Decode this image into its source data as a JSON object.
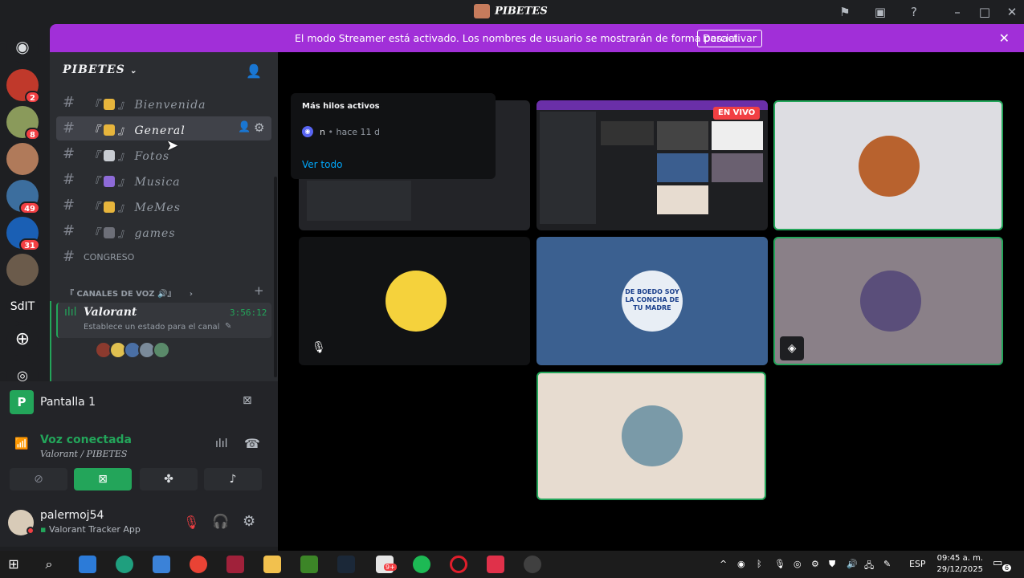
{
  "window": {
    "title": "PIBETES",
    "flag_icon": "flag-icon",
    "inbox_icon": "inbox-icon",
    "help_icon": "help-icon"
  },
  "rail": {
    "servers": [
      {
        "badge": "2",
        "color": "#c0392b"
      },
      {
        "badge": "8",
        "color": "#8a9a5b"
      },
      {
        "badge": "",
        "color": "#b07a5a"
      },
      {
        "badge": "49",
        "color": "#3c6e9e"
      },
      {
        "badge": "31",
        "color": "#1a5fb4"
      },
      {
        "badge": "",
        "color": "#6b5b4b"
      }
    ],
    "text_server": "SdIT"
  },
  "banner": {
    "message": "El modo Streamer está activado. Los nombres de usuario se mostrarán de forma parcial.",
    "button": "Desactivar"
  },
  "sidebar": {
    "server_name": "PIBETES",
    "channels": [
      {
        "prefix": "『",
        "suffix": "』",
        "name": "Bienvenida"
      },
      {
        "prefix": "『",
        "suffix": "』",
        "name": "General"
      },
      {
        "prefix": "『",
        "suffix": "』",
        "name": "Fotos"
      },
      {
        "prefix": "『",
        "suffix": "』",
        "name": "Musica"
      },
      {
        "prefix": "『",
        "suffix": "』",
        "name": "MeMes"
      },
      {
        "prefix": "『",
        "suffix": "』",
        "name": "games"
      }
    ],
    "plain_channel": "CONGRESO",
    "voice_category": "CANALES DE VOZ",
    "voice_category_prefix": "『",
    "voice_category_suffix": "』",
    "voice_channel": {
      "name": "Valorant",
      "timer": "3:56:12",
      "status": "Establece un estado para el canal"
    }
  },
  "screen_panel": {
    "label": "Pantalla 1",
    "avatar_letter": "P"
  },
  "voice_panel": {
    "status": "Voz conectada",
    "location": "Valorant / PIBETES"
  },
  "user_panel": {
    "username": "palermoj54",
    "activity": "Valorant Tracker App"
  },
  "threads_popup": {
    "title": "Más hilos activos",
    "item_name": "n",
    "item_time": "hace 11 d",
    "link": "Ver todo"
  },
  "stage": {
    "live_label": "EN VIVO",
    "sticker_text": "DE BOEDO SOY LA CONCHA DE TU MADRE"
  },
  "taskbar": {
    "language": "ESP",
    "time": "09:45 a. m.",
    "date": "29/12/2025",
    "notifications": "6",
    "files_badge": "9+"
  },
  "colors": {
    "accent_green": "#23a55a",
    "streamer_purple": "#a12fd8",
    "danger_red": "#f23f43"
  }
}
